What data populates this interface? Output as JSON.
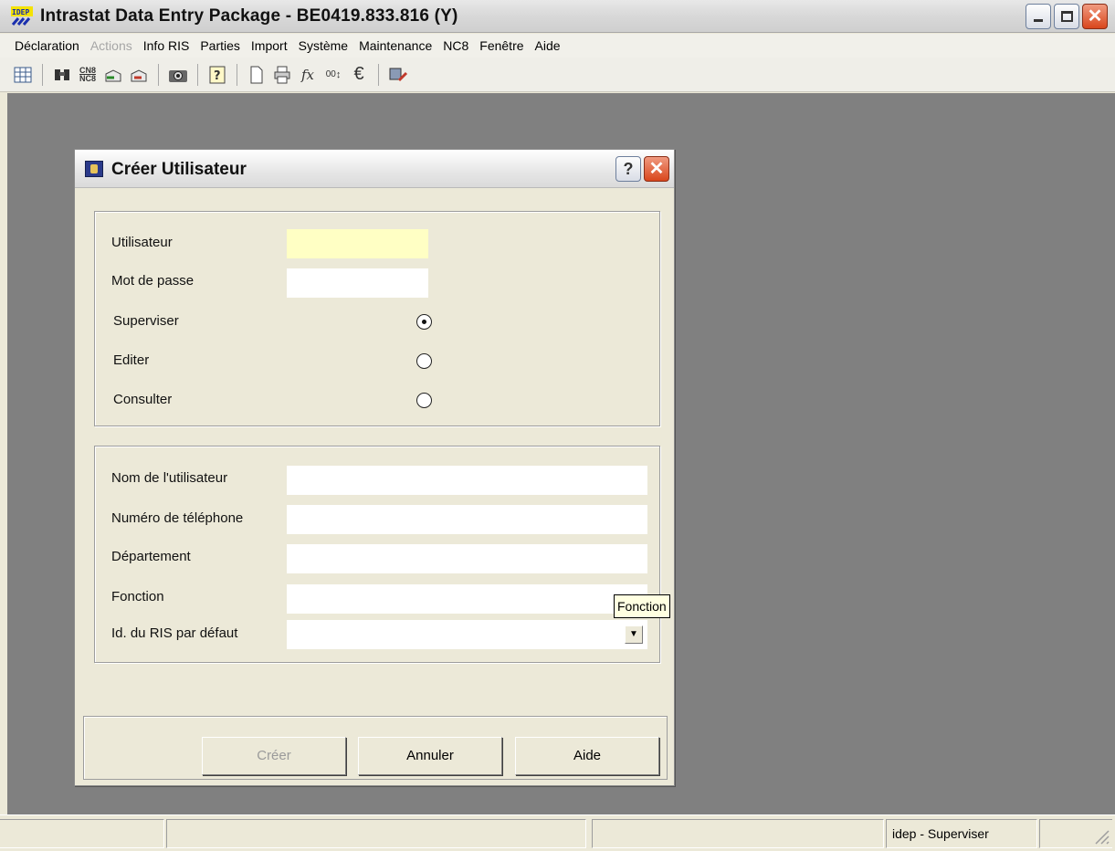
{
  "window": {
    "logo_text": "IDEP",
    "title": "Intrastat Data Entry Package - BE0419.833.816 (Y)"
  },
  "menu": [
    "Déclaration",
    "Actions",
    "Info RIS",
    "Parties",
    "Import",
    "Système",
    "Maintenance",
    "NC8",
    "Fenêtre",
    "Aide"
  ],
  "menu_disabled": [
    "Actions"
  ],
  "toolbar": {
    "cn8_top": "CN8",
    "cn8_bottom": "NC8",
    "fx": "fx",
    "euro": "€",
    "help": "?",
    "spin": "00"
  },
  "dialog": {
    "title": "Créer Utilisateur",
    "help_glyph": "?",
    "close_glyph": "✕",
    "fields": {
      "utilisateur": {
        "label": "Utilisateur",
        "value": ""
      },
      "mot_de_passe": {
        "label": "Mot de passe",
        "value": ""
      },
      "nom": {
        "label": "Nom de l'utilisateur",
        "value": ""
      },
      "telephone": {
        "label": "Numéro de téléphone",
        "value": ""
      },
      "departement": {
        "label": "Département",
        "value": ""
      },
      "fonction": {
        "label": "Fonction",
        "value": ""
      },
      "ris": {
        "label": "Id. du RIS par défaut",
        "value": ""
      }
    },
    "roles": [
      {
        "label": "Superviser",
        "selected": true
      },
      {
        "label": "Editer",
        "selected": false
      },
      {
        "label": "Consulter",
        "selected": false
      }
    ],
    "buttons": {
      "create": "Créer",
      "cancel": "Annuler",
      "help": "Aide"
    },
    "dropdown_glyph": "▼"
  },
  "tooltip": "Fonction",
  "status": {
    "user": "idep - Superviser"
  },
  "colors": {
    "required_field": "#ffffc4",
    "mdi_background": "#808080",
    "close_button": "#d9461c"
  }
}
